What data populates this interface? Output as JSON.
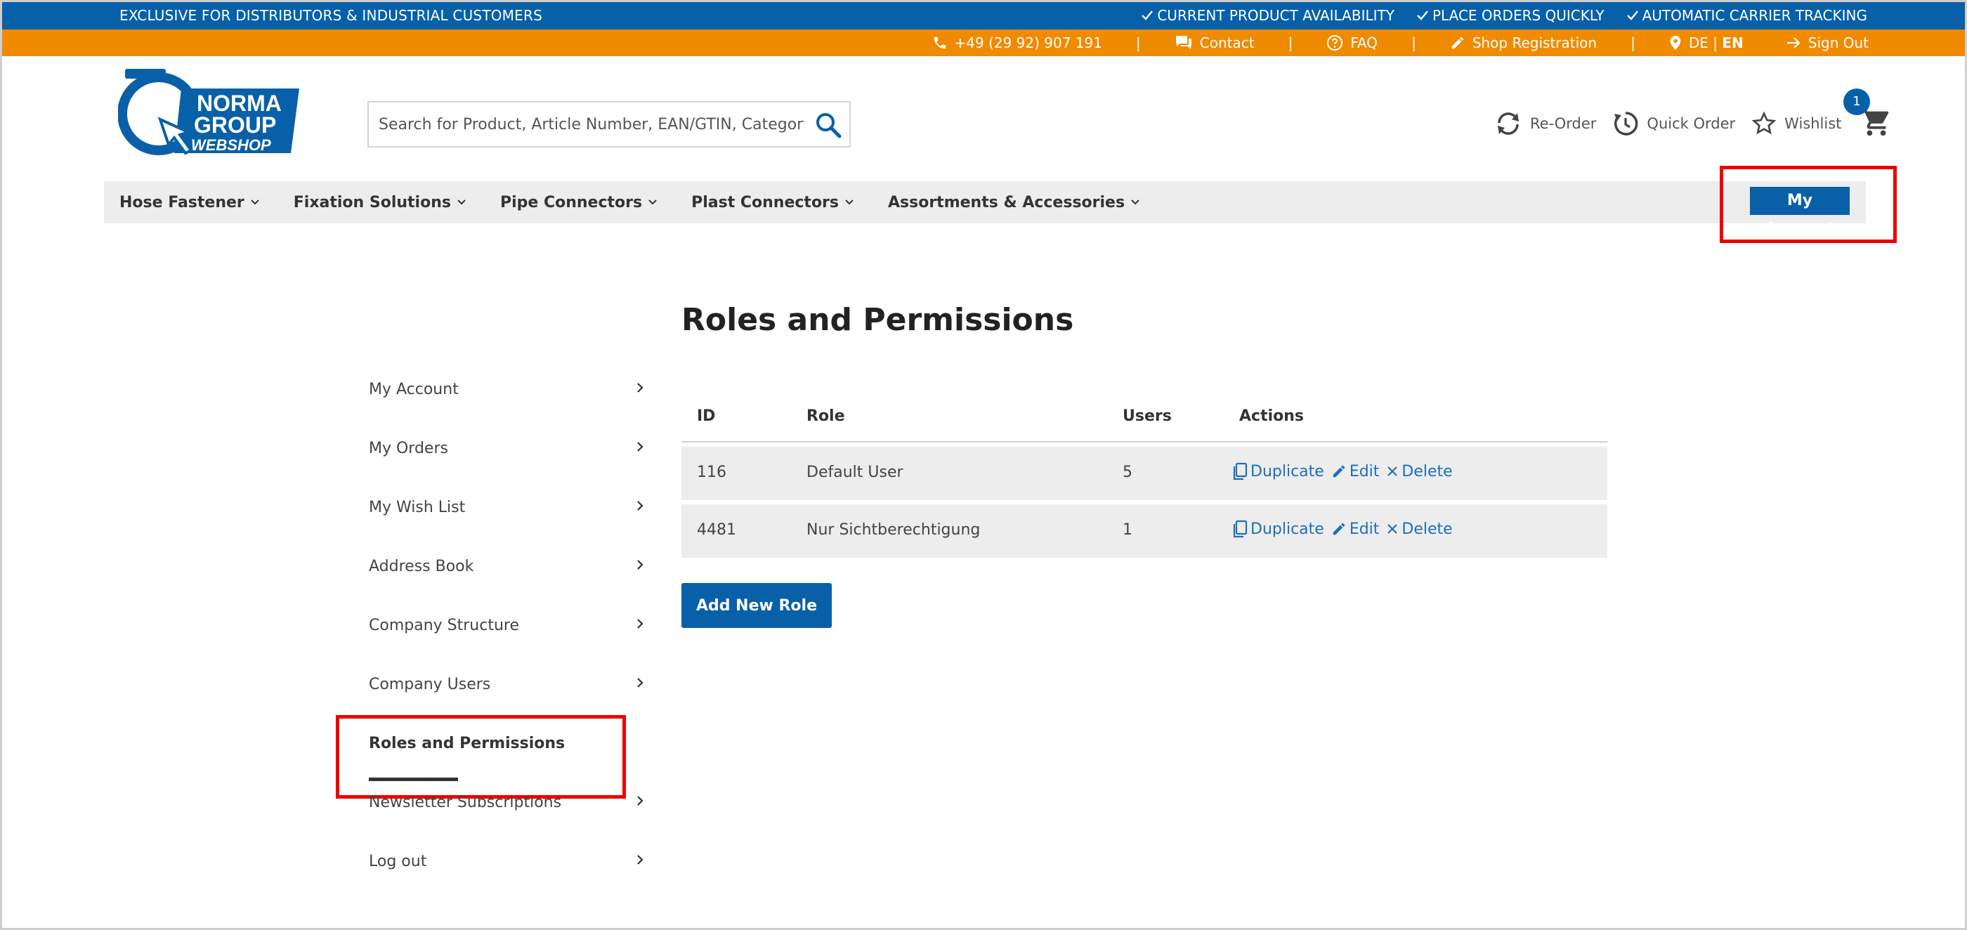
{
  "topbar": {
    "left_text": "EXCLUSIVE FOR DISTRIBUTORS & INDUSTRIAL CUSTOMERS",
    "usps": [
      "CURRENT PRODUCT AVAILABILITY",
      "PLACE ORDERS QUICKLY",
      "AUTOMATIC CARRIER TRACKING"
    ]
  },
  "servicebar": {
    "phone": "+49 (29 92) 907 191",
    "contact": "Contact",
    "faq": "FAQ",
    "registration": "Shop Registration",
    "lang_de": "DE",
    "lang_sep": "|",
    "lang_en": "EN",
    "signout": "Sign Out",
    "separator": "|"
  },
  "logo": {
    "line1": "NORMA",
    "line2": "GROUP",
    "line3": "WEBSHOP"
  },
  "search": {
    "placeholder": "Search for Product, Article Number, EAN/GTIN, Category"
  },
  "header_actions": {
    "reorder": "Re-Order",
    "quick_order": "Quick Order",
    "wishlist": "Wishlist",
    "cart_count": "1"
  },
  "nav": {
    "items": [
      "Hose Fastener",
      "Fixation Solutions",
      "Pipe Connectors",
      "Plast Connectors",
      "Assortments & Accessories"
    ],
    "my_account": "My Account"
  },
  "sidebar": {
    "items": [
      "My Account",
      "My Orders",
      "My Wish List",
      "Address Book",
      "Company Structure",
      "Company Users",
      "Roles and Permissions",
      "Newsletter Subscriptions",
      "Log out"
    ],
    "active": "Roles and Permissions"
  },
  "main": {
    "title": "Roles and Permissions",
    "columns": [
      "ID",
      "Role",
      "Users",
      "Actions"
    ],
    "rows": [
      {
        "id": "116",
        "role": "Default User",
        "users": "5"
      },
      {
        "id": "4481",
        "role": "Nur Sichtberechtigung",
        "users": "1"
      }
    ],
    "actions": {
      "duplicate": "Duplicate",
      "edit": "Edit",
      "delete": "Delete"
    },
    "add_button": "Add New Role"
  },
  "colors": {
    "brand_blue": "#0860a8",
    "brand_orange": "#f08a00",
    "highlight_red": "#ee0000",
    "link_blue": "#1d6fb8"
  }
}
